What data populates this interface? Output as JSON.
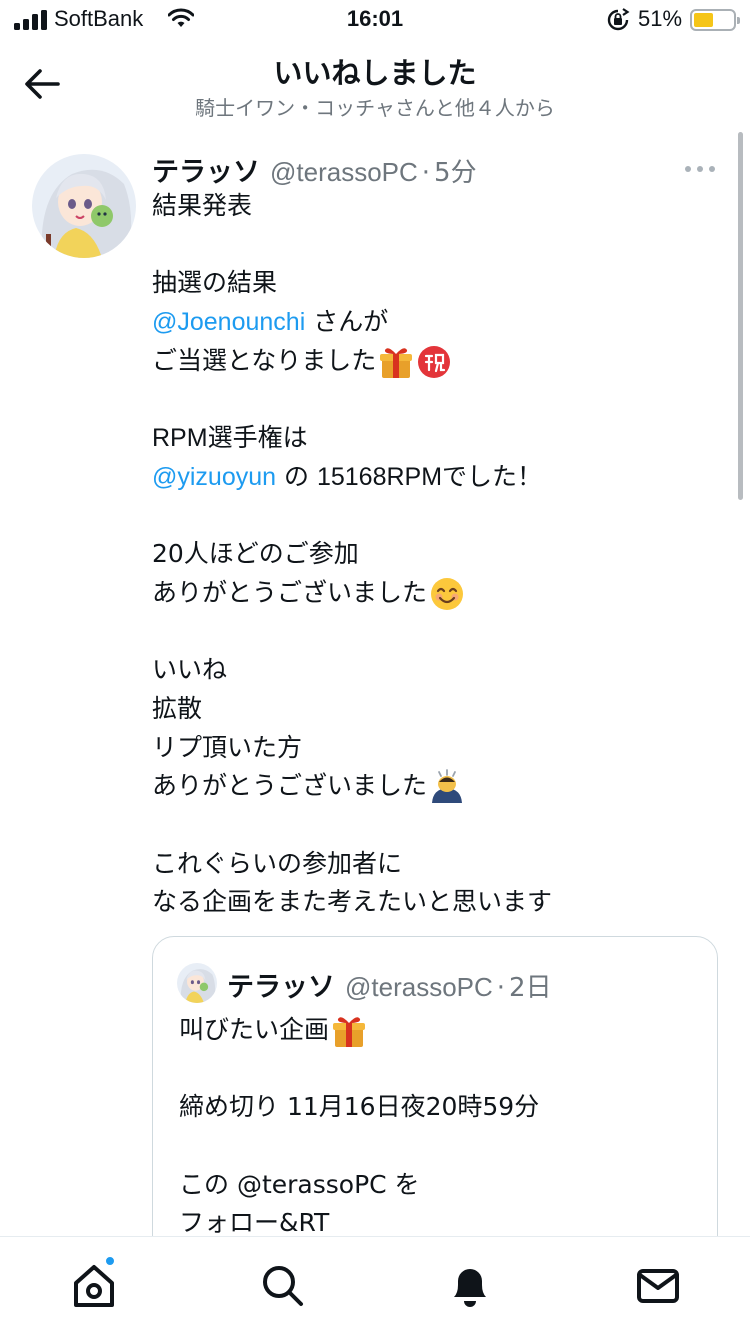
{
  "status_bar": {
    "carrier": "SoftBank",
    "time": "16:01",
    "battery_percent": "51%",
    "battery_level": 0.51
  },
  "header": {
    "title": "いいねしました",
    "subtitle": "騎士イワン・コッチャさんと他４人から"
  },
  "tweet": {
    "name": "テラッソ",
    "handle": "@terassoPC",
    "separator": "·",
    "time": "5分",
    "lines": [
      "結果発表",
      "",
      "抽選の結果",
      {
        "mention": "@Joenounchi",
        "text": " さんが"
      },
      {
        "text": "ご当選となりました",
        "emoji": [
          "gift-emoji",
          "congratulations-emoji"
        ]
      },
      "",
      {
        "latin": "RPM",
        "text": "選手権は"
      },
      {
        "mention": "@yizuoyun",
        "text": " の ",
        "latin": "15168RPM",
        "after": "でした！"
      },
      "",
      "20人ほどのご参加",
      {
        "text": "ありがとうございました",
        "emoji": [
          "smiling-face-emoji"
        ]
      },
      "",
      "いいね",
      "拡散",
      "リプ頂いた方",
      {
        "text": "ありがとうございました",
        "emoji": [
          "bowing-person-emoji"
        ]
      },
      "",
      "これぐらいの参加者に",
      "なる企画をまた考えたいと思います"
    ]
  },
  "quote": {
    "name": "テラッソ",
    "handle": "@terassoPC",
    "separator": "·",
    "time": "2日",
    "lines": [
      {
        "text": "叫びたい企画",
        "emoji": [
          "gift-emoji"
        ]
      },
      "",
      "締め切り 11月16日夜20時59分",
      "",
      "この @terassoPC を",
      "フォロー&RT"
    ]
  },
  "tabbar": {
    "items": [
      "home-tab",
      "search-tab",
      "notifications-tab",
      "messages-tab"
    ],
    "home_has_new": true
  },
  "colors": {
    "accent": "#1d9bf0",
    "text": "#0f1419",
    "secondary": "#6e767d",
    "border": "#cfd9de"
  }
}
